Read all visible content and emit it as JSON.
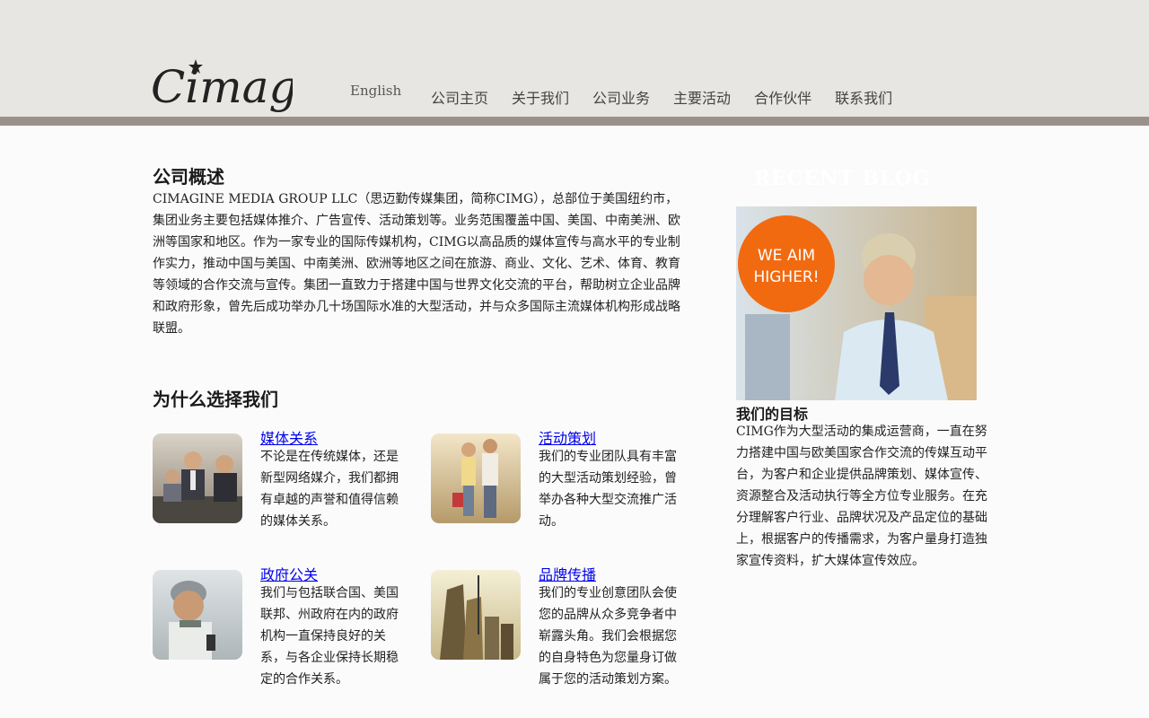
{
  "nav": {
    "logo_text": "Cimagine",
    "english": "English",
    "items": [
      "公司主页",
      "关于我们",
      "公司业务",
      "主要活动",
      "合作伙伴",
      "联系我们"
    ]
  },
  "overview": {
    "title": "公司概述",
    "text": "CIMAGINE MEDIA GROUP LLC（思迈勤传媒集团，简称CIMG），总部位于美国纽约市，集团业务主要包括媒体推介、广告宣传、活动策划等。业务范围覆盖中国、美国、中南美洲、欧洲等国家和地区。作为一家专业的国际传媒机构，CIMG以高品质的媒体宣传与高水平的专业制作实力，推动中国与美国、中南美洲、欧洲等地区之间在旅游、商业、文化、艺术、体育、教育等领域的合作交流与宣传。集团一直致力于搭建中国与世界文化交流的平台，帮助树立企业品牌和政府形象，曾先后成功举办几十场国际水准的大型活动，并与众多国际主流媒体机构形成战略联盟。"
  },
  "why": {
    "title": "为什么选择我们",
    "services": [
      {
        "title": "媒体关系",
        "desc": "不论是在传统媒体，还是新型网络媒介，我们都拥有卓越的声誉和值得信赖的媒体关系。"
      },
      {
        "title": "活动策划",
        "desc": "我们的专业团队具有丰富的大型活动策划经验，曾举办各种大型交流推广活动。"
      },
      {
        "title": "政府公关",
        "desc": "我们与包括联合国、美国联邦、州政府在内的政府机构一直保持良好的关系，与各企业保持长期稳定的合作关系。"
      },
      {
        "title": "品牌传播",
        "desc": "我们的专业创意团队会使您的品牌从众多竞争者中崭露头角。我们会根据您的自身特色为您量身订做属于您的活动策划方案。"
      }
    ]
  },
  "sidebar": {
    "blog_heading": "RECENT BLOG",
    "badge_line1": "WE AIM",
    "badge_line2": "HIGHER!",
    "goal_title": "我们的目标",
    "goal_text": "CIMG作为大型活动的集成运营商，一直在努力搭建中国与欧美国家合作交流的传媒互动平台，为客户和企业提供品牌策划、媒体宣传、资源整合及活动执行等全方位专业服务。在充分理解客户行业、品牌状况及产品定位的基础上，根据客户的传播需求，为客户量身打造独家宣传资料，扩大媒体宣传效应。"
  },
  "colors": {
    "header_bg": "#e8e6e2",
    "header_bar": "#9b918a",
    "link": "#0000ee",
    "badge": "#f26a10"
  }
}
